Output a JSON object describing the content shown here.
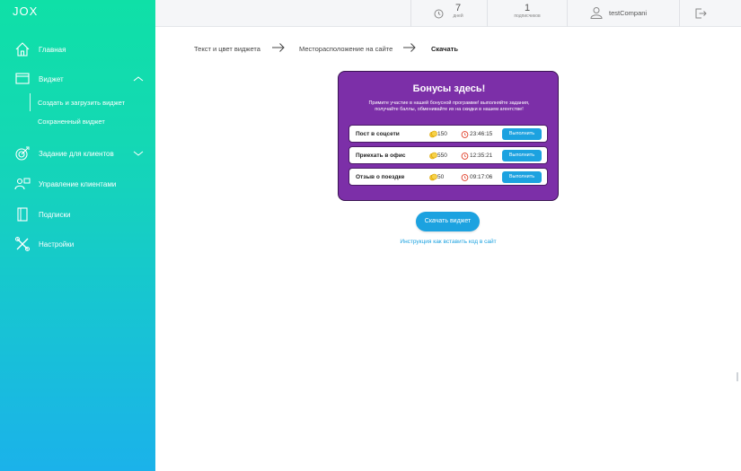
{
  "app": {
    "logo": "JOX"
  },
  "sidebar": {
    "items": [
      {
        "label": "Главная",
        "icon": "home-icon"
      },
      {
        "label": "Виджет",
        "icon": "widget-window-icon"
      },
      {
        "label": "Задание для клиентов",
        "icon": "target-icon"
      },
      {
        "label": "Управление клиентами",
        "icon": "client-management-icon"
      },
      {
        "label": "Подписки",
        "icon": "notebook-icon"
      },
      {
        "label": "Настройки",
        "icon": "tools-icon"
      }
    ],
    "widget_sub": [
      {
        "label": "Создать и загрузить виджет"
      },
      {
        "label": "Сохраненный виджет"
      }
    ]
  },
  "topbar": {
    "days": {
      "value": "7",
      "caption": "дней"
    },
    "subscribers": {
      "value": "1",
      "caption": "подписчиков"
    },
    "user": "testCompani"
  },
  "steps": [
    {
      "label": "Текст и цвет виджета"
    },
    {
      "label": "Месторасположение на сайте"
    },
    {
      "label": "Скачать"
    }
  ],
  "widget": {
    "title": "Бонусы здесь!",
    "description": "Примите участие в нашей бонусной программе! выполняйте задания, получайте баллы, обменивайте их на скидки в нашем агентстве!",
    "tasks": [
      {
        "name": "Пост в соцсети",
        "points": "150",
        "time": "23:46:15",
        "button": "Выполнить"
      },
      {
        "name": "Приехать в офис",
        "points": "550",
        "time": "12:35:21",
        "button": "Выполнить"
      },
      {
        "name": "Отзыв о поездке",
        "points": "50",
        "time": "09:17:06",
        "button": "Выполнить"
      }
    ]
  },
  "actions": {
    "download": "Скачать виджет",
    "instructions": "Инструкция как вставить код в сайт"
  },
  "colors": {
    "sidebar_top": "#0fe0a7",
    "sidebar_bottom": "#1bb2ea",
    "widget_bg": "#7c2fa8",
    "accent": "#1ca2e0"
  }
}
